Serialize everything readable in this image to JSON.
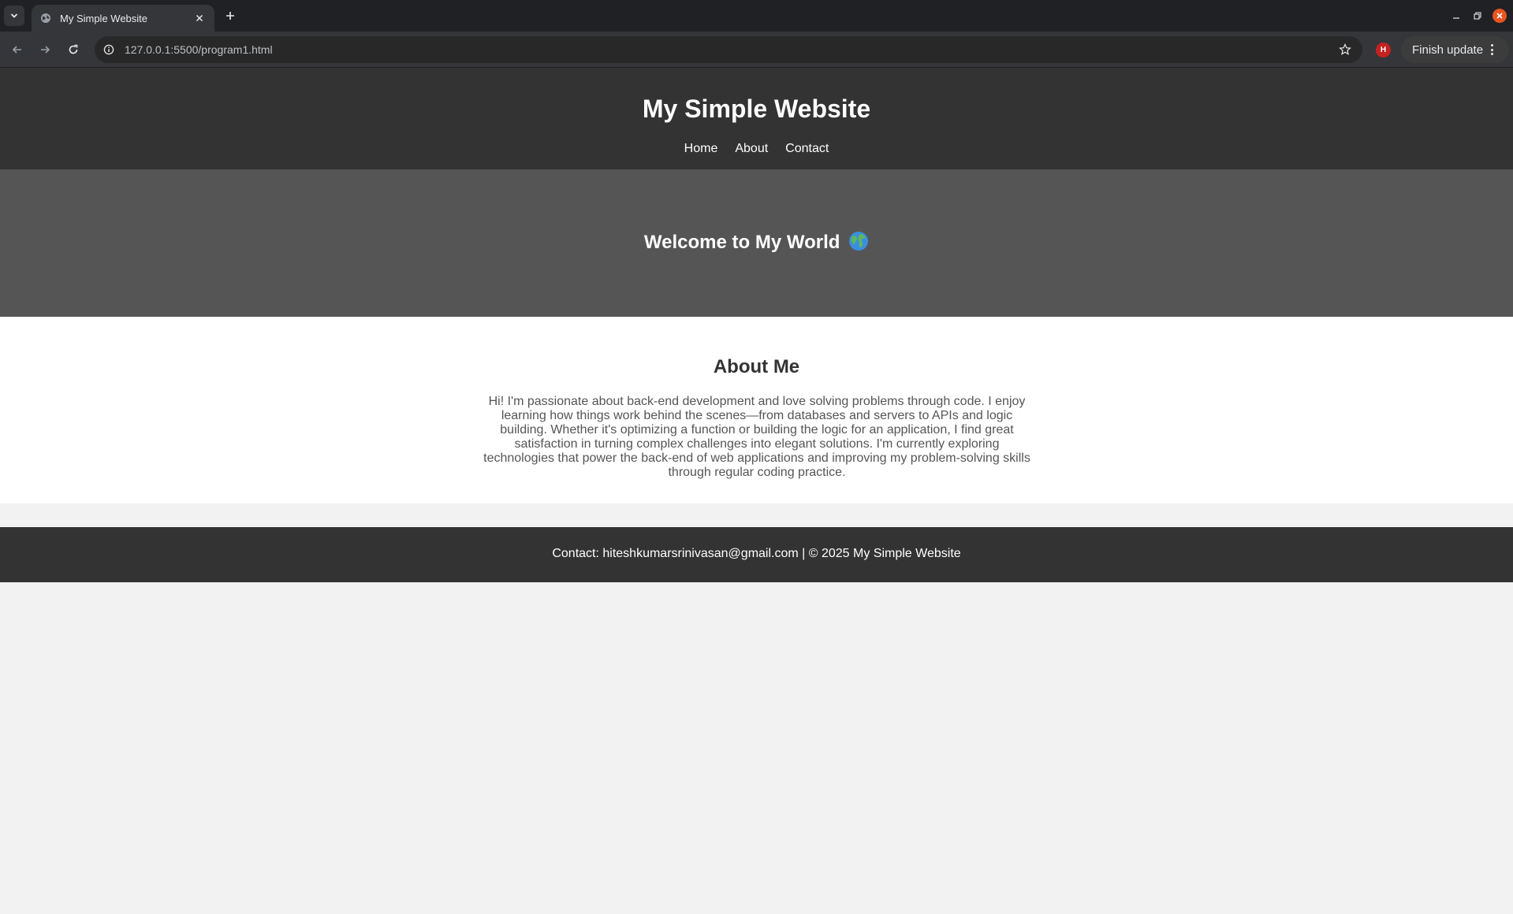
{
  "browser": {
    "tab_title": "My Simple Website",
    "url": "127.0.0.1:5500/program1.html",
    "profile_initial": "H",
    "update_label": "Finish update"
  },
  "header": {
    "title": "My Simple Website",
    "nav": [
      "Home",
      "About",
      "Contact"
    ]
  },
  "hero": {
    "title": "Welcome to My World"
  },
  "about": {
    "title": "About Me",
    "text": "Hi! I'm passionate about back-end development and love solving problems through code. I enjoy learning how things work behind the scenes—from databases and servers to APIs and logic building. Whether it's optimizing a function or building the logic for an application, I find great satisfaction in turning complex challenges into elegant solutions. I'm currently exploring technologies that power the back-end of web applications and improving my problem-solving skills through regular coding practice."
  },
  "footer": {
    "text": "Contact: hiteshkumarsrinivasan@gmail.com | © 2025 My Simple Website"
  },
  "colors": {
    "header_bg": "#333333",
    "hero_bg": "#555555",
    "page_bg": "#f2f2f2",
    "window_close": "#e95420",
    "profile": "#c5221f"
  },
  "icons": {
    "tab_search": "chevron-down-icon",
    "favicon": "globe-icon",
    "tab_close": "close-icon",
    "new_tab": "plus-icon",
    "back": "arrow-left-icon",
    "forward": "arrow-right-icon",
    "reload": "reload-icon",
    "site_info": "info-icon",
    "bookmark": "star-icon",
    "hero_emoji": "earth-globe-icon"
  }
}
